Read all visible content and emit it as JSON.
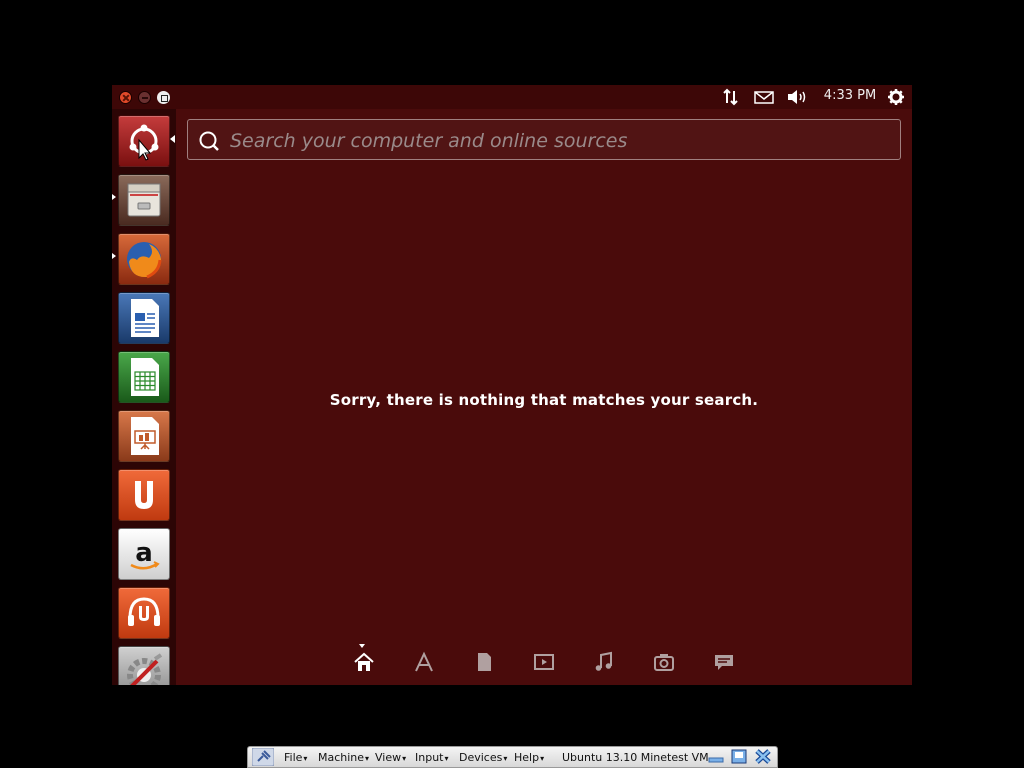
{
  "panel": {
    "time": "4:33 PM"
  },
  "launcher": {
    "items": [
      {
        "name": "Dash Home"
      },
      {
        "name": "Files"
      },
      {
        "name": "Firefox Web Browser"
      },
      {
        "name": "LibreOffice Writer"
      },
      {
        "name": "LibreOffice Calc"
      },
      {
        "name": "LibreOffice Impress"
      },
      {
        "name": "Ubuntu Software Center"
      },
      {
        "name": "Amazon"
      },
      {
        "name": "Ubuntu One Music"
      },
      {
        "name": "System Settings"
      }
    ]
  },
  "dash": {
    "search_placeholder": "Search your computer and online sources",
    "search_value": "",
    "empty_message": "Sorry, there is nothing that matches your search.",
    "lenses": [
      "home",
      "applications",
      "files",
      "video",
      "music",
      "photos",
      "social"
    ],
    "active_lens": "home"
  },
  "vbox": {
    "menus": [
      "File",
      "Machine",
      "View",
      "Input",
      "Devices",
      "Help"
    ],
    "title": "Ubuntu 13.10 Minetest VM"
  },
  "colors": {
    "dash_bg": "#4a0b0b",
    "launcher_bg": "#2c0505",
    "text": "#ffffff"
  }
}
